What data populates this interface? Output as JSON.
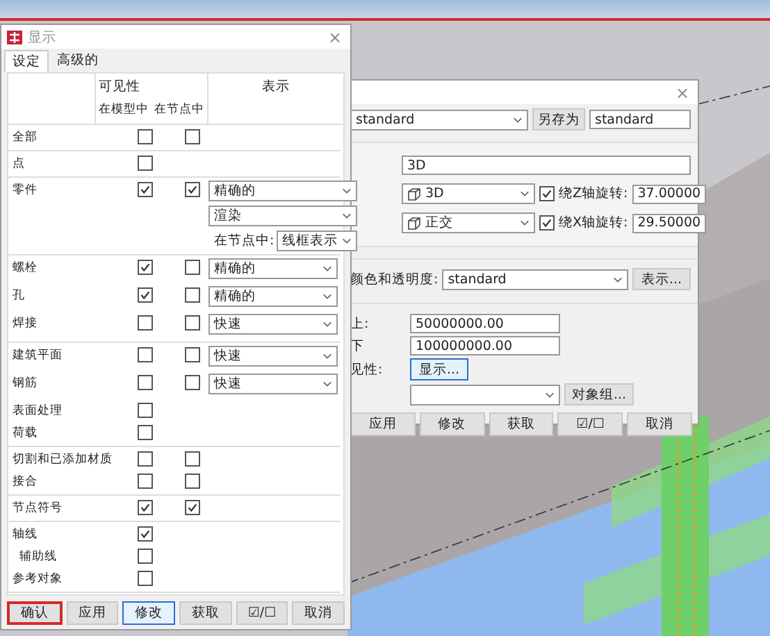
{
  "display_dialog": {
    "title": "显示",
    "close": "×",
    "tabs": [
      {
        "label": "设定",
        "selected": true
      },
      {
        "label": "高级的",
        "selected": false
      }
    ],
    "headers": {
      "visibility": "可见性",
      "in_model": "在模型中",
      "in_component": "在节点中",
      "representation": "表示"
    },
    "groups": [
      {
        "rows": [
          {
            "label": "全部",
            "in_model": false,
            "in_component": false
          }
        ]
      },
      {
        "rows": [
          {
            "label": "点",
            "in_model": false
          }
        ]
      },
      {
        "rows": [
          {
            "label": "零件",
            "in_model": true,
            "in_component": true,
            "representation": [
              {
                "value": "精确的"
              },
              {
                "value": "渲染"
              },
              {
                "prefix": "在节点中:",
                "value": "线框表示"
              }
            ]
          }
        ]
      },
      {
        "rows": [
          {
            "label": "螺栓",
            "in_model": true,
            "in_component": false,
            "representation": [
              {
                "value": "精确的"
              }
            ]
          },
          {
            "label": "孔",
            "in_model": true,
            "in_component": false,
            "representation": [
              {
                "value": "精确的"
              }
            ]
          },
          {
            "label": "焊接",
            "in_model": false,
            "in_component": false,
            "representation": [
              {
                "value": "快速"
              }
            ]
          }
        ]
      },
      {
        "rows": [
          {
            "label": "建筑平面",
            "in_model": false,
            "in_component": false,
            "representation": [
              {
                "value": "快速"
              }
            ]
          },
          {
            "label": "钢筋",
            "in_model": false,
            "in_component": false,
            "representation": [
              {
                "value": "快速"
              }
            ]
          },
          {
            "label": "表面处理",
            "in_model": false
          },
          {
            "label": "荷载",
            "in_model": false
          }
        ]
      },
      {
        "rows": [
          {
            "label": "切割和已添加材质",
            "in_model": false,
            "in_component": false
          },
          {
            "label": "接合",
            "in_model": false,
            "in_component": false
          }
        ]
      },
      {
        "rows": [
          {
            "label": "节点符号",
            "in_model": true,
            "in_component": true
          }
        ]
      },
      {
        "rows": [
          {
            "label": "轴线",
            "in_model": true,
            "children": [
              {
                "label": "辅助线",
                "in_model": false
              }
            ]
          },
          {
            "label": "参考对象",
            "in_model": false
          }
        ]
      }
    ],
    "buttons": [
      {
        "label": "确认",
        "kind": "annotated"
      },
      {
        "label": "应用",
        "kind": "normal"
      },
      {
        "label": "修改",
        "kind": "default"
      },
      {
        "label": "获取",
        "kind": "normal"
      },
      {
        "label": "☑/☐",
        "kind": "normal"
      },
      {
        "label": "取消",
        "kind": "normal"
      }
    ]
  },
  "view_dialog": {
    "close": "×",
    "preset": "standard",
    "save_as_button": "另存为",
    "save_as_value": "standard",
    "name_value": "3D",
    "projection_rows": [
      {
        "value": "3D",
        "rotation_label": "绕Z轴旋转:",
        "rotation_checked": true,
        "rotation_value": "37.00000"
      },
      {
        "value": "正交",
        "rotation_label": "绕X轴旋转:",
        "rotation_checked": true,
        "rotation_value": "29.50000"
      }
    ],
    "color_label": "颜色和透明度:",
    "color_value": "standard",
    "color_button": "表示...",
    "depth_rows": [
      {
        "label": "上:",
        "value": "50000000.00"
      },
      {
        "label": "下",
        "value": "100000000.00"
      }
    ],
    "visibility_label": "见性:",
    "visibility_button": "显示...",
    "object_group_button": "对象组...",
    "buttons": [
      {
        "label": "应用"
      },
      {
        "label": "修改"
      },
      {
        "label": "获取"
      },
      {
        "label": "☑/☐"
      },
      {
        "label": "取消"
      }
    ]
  }
}
